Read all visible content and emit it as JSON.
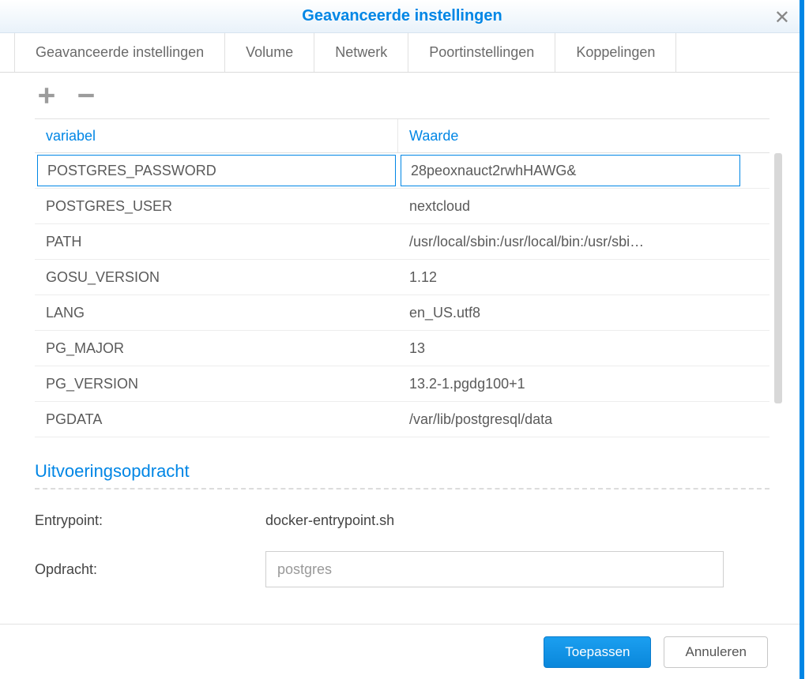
{
  "dialog": {
    "title": "Geavanceerde instellingen"
  },
  "tabs": [
    {
      "label": "Geavanceerde instellingen"
    },
    {
      "label": "Volume"
    },
    {
      "label": "Netwerk"
    },
    {
      "label": "Poortinstellingen"
    },
    {
      "label": "Koppelingen"
    }
  ],
  "table": {
    "header_var": "variabel",
    "header_val": "Waarde",
    "rows": [
      {
        "var": "POSTGRES_PASSWORD",
        "val": "28peoxnauct2rwhHAWG&",
        "selected": true
      },
      {
        "var": "POSTGRES_USER",
        "val": "nextcloud"
      },
      {
        "var": "PATH",
        "val": "/usr/local/sbin:/usr/local/bin:/usr/sbi…"
      },
      {
        "var": "GOSU_VERSION",
        "val": "1.12"
      },
      {
        "var": "LANG",
        "val": "en_US.utf8"
      },
      {
        "var": "PG_MAJOR",
        "val": "13"
      },
      {
        "var": "PG_VERSION",
        "val": "13.2-1.pgdg100+1"
      },
      {
        "var": "PGDATA",
        "val": "/var/lib/postgresql/data"
      }
    ]
  },
  "exec": {
    "section_title": "Uitvoeringsopdracht",
    "entrypoint_label": "Entrypoint:",
    "entrypoint_value": "docker-entrypoint.sh",
    "command_label": "Opdracht:",
    "command_value": "postgres"
  },
  "footer": {
    "apply": "Toepassen",
    "cancel": "Annuleren"
  }
}
